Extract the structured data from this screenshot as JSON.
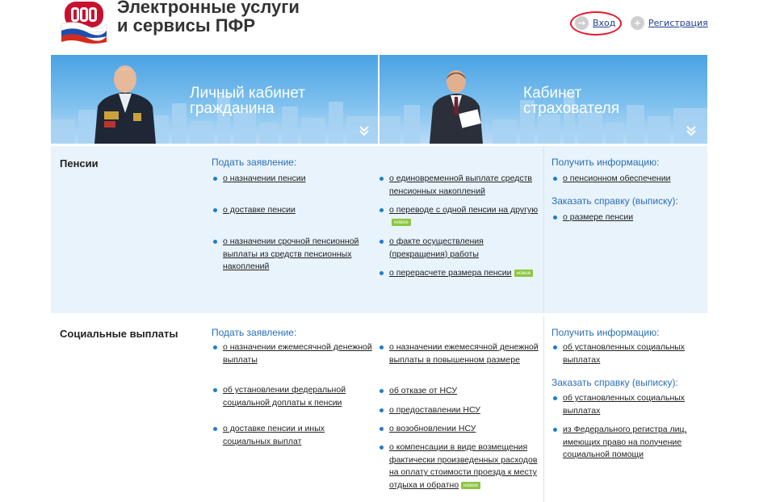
{
  "header": {
    "title_line1": "Электронные услуги",
    "title_line2": "и сервисы ПФР",
    "login_label": "Вход",
    "register_label": "Регистрация"
  },
  "banner": {
    "citizen": {
      "line1": "Личный кабинет",
      "line2": "гражданина"
    },
    "insurer": {
      "line1": "Кабинет",
      "line2": "страхователя"
    }
  },
  "pensions": {
    "title": "Пенсии",
    "apply_header": "Подать заявление:",
    "col1": [
      "о назначении пенсии",
      "о доставке пенсии",
      "о назначении срочной пенсионной выплаты из средств пенсионных накоплений"
    ],
    "col2": [
      "о единовременной выплате средств пенсионных накоплений",
      "о переводе с одной пенсии на другую",
      "о факте осуществления (прекращения) работы",
      "о перерасчете размера пенсии"
    ],
    "info_header": "Получить информацию:",
    "info_items": [
      "о пенсионном обеспечении"
    ],
    "order_header": "Заказать справку (выписку):",
    "order_items": [
      "о размере пенсии"
    ]
  },
  "social": {
    "title": "Социальные выплаты",
    "apply_header": "Подать заявление:",
    "col1": [
      "о назначении ежемесячной денежной выплаты",
      "об установлении федеральной социальной доплаты к пенсии",
      "о доставке пенсии и иных социальных выплат"
    ],
    "col2": [
      "о назначении ежемесячной денежной выплаты в повышенном размере",
      "об отказе от НСУ",
      "о предоставлении НСУ",
      "о возобновлении НСУ",
      "о компенсации в виде возмещения фактически произведенных расходов на оплату стоимости проезда к месту отдыха и обратно"
    ],
    "info_header": "Получить информацию:",
    "info_items": [
      "об установленных социальных выплатах"
    ],
    "order_header": "Заказать справку (выписку):",
    "order_items": [
      "об установленных социальных выплатах",
      "из Федерального регистра лиц, имеющих право на получение социальной помощи"
    ]
  },
  "badge_label": "новое",
  "colors": {
    "link_header": "#2a6fb5",
    "bullet": "#1f7cd0",
    "section_bg": "#e8f3fc",
    "badge": "#8cc63f",
    "login_highlight": "#e8172e"
  },
  "icons": {
    "logo": "pfr-logo-icon",
    "login": "login-arrow-icon",
    "register": "plus-icon",
    "expand": "chevron-double-down-icon"
  }
}
